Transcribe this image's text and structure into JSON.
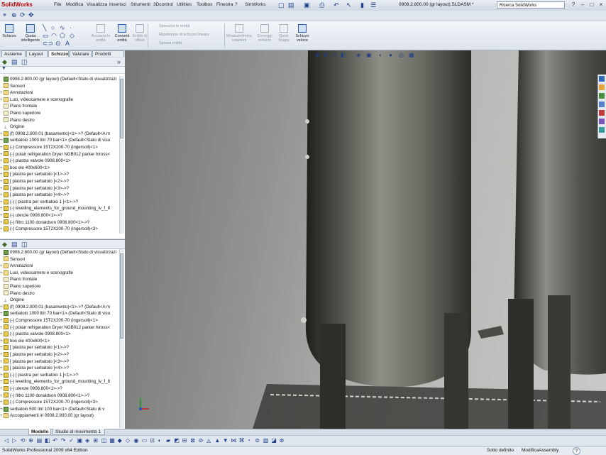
{
  "app": {
    "logo": "SolidWorks",
    "menus": [
      "File",
      "Modifica",
      "Visualizza",
      "Inserisci",
      "Strumenti",
      "3Dcontrol",
      "Utilities",
      "Toolbox",
      "Finestra",
      "?",
      "SimWorks"
    ],
    "doc_title": "0908.2.800.00 (gr layout).SLDASM *",
    "search_placeholder": "Ricerca SolidWorks",
    "win_buttons": [
      "?",
      "–",
      "□",
      "×"
    ]
  },
  "ribbon": {
    "buttons": [
      {
        "label": "Schizzo",
        "disabled": false
      },
      {
        "label": "Quota intelligente",
        "disabled": false
      },
      {
        "label": "Accorcia le entità",
        "disabled": true
      },
      {
        "label": "Converti entità",
        "disabled": false
      },
      {
        "label": "Entità di offset",
        "disabled": true
      },
      {
        "label": "Mostra/elimina relazioni",
        "disabled": true
      },
      {
        "label": "Correggi schizzo",
        "disabled": true
      },
      {
        "label": "Quick Snaps",
        "disabled": true
      },
      {
        "label": "Schizzo veloce",
        "disabled": false
      }
    ],
    "disabled_lines": [
      "Specchia le entità",
      "Ripetizione di schizzo lineare",
      "Sposta entità"
    ]
  },
  "command_tabs": [
    {
      "label": "Assieme",
      "active": false
    },
    {
      "label": "Layout",
      "active": false
    },
    {
      "label": "Schizzo",
      "active": true
    },
    {
      "label": "Valutare",
      "active": false
    },
    {
      "label": "Prodotti Office",
      "active": false
    }
  ],
  "tree_top": [
    {
      "text": "0908.2.800.00 (gr layout)  (Default<Stato di visualizzazi",
      "icon": "assy",
      "plus": ""
    },
    {
      "text": "Sensori",
      "icon": "folder",
      "plus": ""
    },
    {
      "text": "Annotazioni",
      "icon": "folder",
      "plus": "+"
    },
    {
      "text": "Luci, videocamere e scenografie",
      "icon": "folder",
      "plus": "+"
    },
    {
      "text": "Piano frontale",
      "icon": "plane",
      "plus": ""
    },
    {
      "text": "Piano superiore",
      "icon": "plane",
      "plus": ""
    },
    {
      "text": "Piano destro",
      "icon": "plane",
      "plus": ""
    },
    {
      "text": "Origine",
      "icon": "origin",
      "plus": ""
    },
    {
      "text": "(f) 0908.2.800.01 (basamento)<1>->? (Default<A m",
      "icon": "part",
      "plus": "+"
    },
    {
      "text": "serbatoio 1000 litri 70 bar<1> (Default<Stato di visu",
      "icon": "assy",
      "plus": "+"
    },
    {
      "text": "(-) Compressore 15T2X200-70 (ingersoll)<1>",
      "icon": "part",
      "plus": "+"
    },
    {
      "text": "(-) polair refrigeration Dryer NGB012 parker hiross<",
      "icon": "part",
      "plus": "+"
    },
    {
      "text": "(-) piastra valvole 0908.800<1>",
      "icon": "part",
      "plus": "+"
    },
    {
      "text": "box ele 400x600<1>",
      "icon": "part",
      "plus": "+"
    },
    {
      "text": "[ piastra per serbatoio ]<1>->?",
      "icon": "part",
      "plus": "+"
    },
    {
      "text": "[ piastra per serbatoio ]<2>->?",
      "icon": "part",
      "plus": "+"
    },
    {
      "text": "[ piastra per serbatoio ]<3>->?",
      "icon": "part",
      "plus": "+"
    },
    {
      "text": "[ piastra per serbatoio ]<4>->?",
      "icon": "part",
      "plus": "+"
    },
    {
      "text": "(-) [ piastra per serbatoio 1 ]<1>->?",
      "icon": "part",
      "plus": "+"
    },
    {
      "text": "(-) levelling_elements_for_ground_mounting_lv_f_8",
      "icon": "part",
      "plus": "+"
    },
    {
      "text": "(-) utenze 0908.800<1>->?",
      "icon": "part",
      "plus": "+"
    },
    {
      "text": "(-) filtro 1100 donaldson 0908.800<1>->?",
      "icon": "part",
      "plus": "+"
    },
    {
      "text": "(-) Compressore 15T2X200-70 (ingersoll)<3>",
      "icon": "part",
      "plus": "+"
    }
  ],
  "tree_bottom": [
    {
      "text": "0908.2.800.00 (gr layout)  (Default<Stato di visualizzazi",
      "icon": "assy",
      "plus": ""
    },
    {
      "text": "Sensori",
      "icon": "folder",
      "plus": ""
    },
    {
      "text": "Annotazioni",
      "icon": "folder",
      "plus": "+"
    },
    {
      "text": "Luci, videocamere e scenografie",
      "icon": "folder",
      "plus": "+"
    },
    {
      "text": "Piano frontale",
      "icon": "plane",
      "plus": ""
    },
    {
      "text": "Piano superiore",
      "icon": "plane",
      "plus": ""
    },
    {
      "text": "Piano destro",
      "icon": "plane",
      "plus": ""
    },
    {
      "text": "Origine",
      "icon": "origin",
      "plus": ""
    },
    {
      "text": "(f) 0908.2.800.01 (basamento)<1>->? (Default<A m",
      "icon": "part",
      "plus": "+"
    },
    {
      "text": "serbatoio 1000 litri 70 bar<1> (Default<Stato di visu",
      "icon": "assy",
      "plus": "+"
    },
    {
      "text": "(-) Compressore 15T2X200-70 (ingersoll)<1>",
      "icon": "part",
      "plus": "+"
    },
    {
      "text": "(-) polair refrigeration Dryer NGB012 parker hiross<",
      "icon": "part",
      "plus": "+"
    },
    {
      "text": "(-) piastra valvole 0908.800<1>",
      "icon": "part",
      "plus": "+"
    },
    {
      "text": "box ele 400x600<1>",
      "icon": "part",
      "plus": "+"
    },
    {
      "text": "[ piastra per serbatoio ]<1>->?",
      "icon": "part",
      "plus": "+"
    },
    {
      "text": "[ piastra per serbatoio ]<2>->?",
      "icon": "part",
      "plus": "+"
    },
    {
      "text": "[ piastra per serbatoio ]<3>->?",
      "icon": "part",
      "plus": "+"
    },
    {
      "text": "[ piastra per serbatoio ]<4>->?",
      "icon": "part",
      "plus": "+"
    },
    {
      "text": "(-) [ piastra per serbatoio 1 ]<1>->?",
      "icon": "part",
      "plus": "+"
    },
    {
      "text": "(-) levelling_elements_for_ground_mounting_lv_f_8",
      "icon": "part",
      "plus": "+"
    },
    {
      "text": "(-) utenze 0908.800<1>->?",
      "icon": "part",
      "plus": "+"
    },
    {
      "text": "(-) filtro 1100 donaldson 0908.800<1>->?",
      "icon": "part",
      "plus": "+"
    },
    {
      "text": "(-) Compressore 15T2X200-70 (ingersoll)<3>",
      "icon": "part",
      "plus": "+"
    },
    {
      "text": "serbatoio 500 litri 100 bar<1> (Default<Stato di v",
      "icon": "assy",
      "plus": "+"
    },
    {
      "text": "Accoppiamenti in 0908.2.800.00 (gr layout)",
      "icon": "folder",
      "plus": "+"
    }
  ],
  "bottom_tabs": [
    {
      "label": "Modello",
      "active": true
    },
    {
      "label": "Studio di movimento 1",
      "active": false
    }
  ],
  "status": {
    "left": "SolidWorks Professional 2009 x64 Edition",
    "state": "Sotto definito",
    "mode": "ModificaAssembly",
    "help": "?"
  },
  "colors": {
    "accent": "#2a5da8",
    "brand": "#b00000"
  }
}
